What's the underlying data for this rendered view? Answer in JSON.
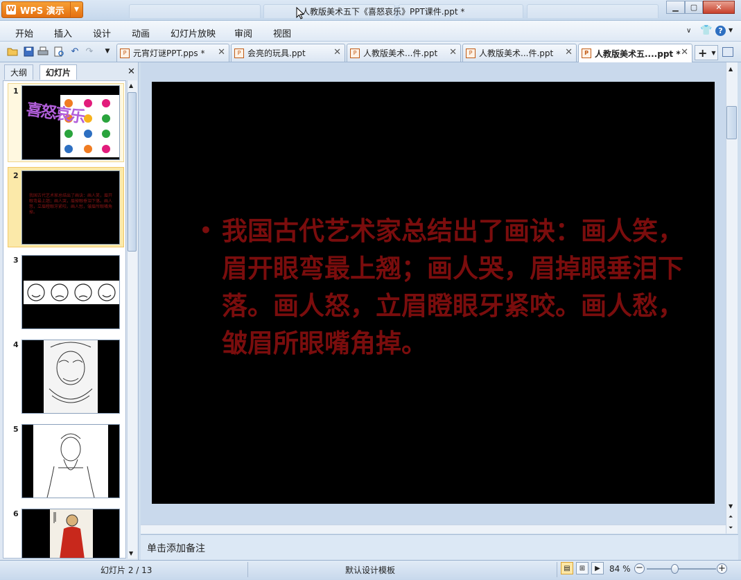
{
  "app": {
    "menu_button": "WPS 演示",
    "logo_letter": "W",
    "window_title": "人教版美术五下《喜怒哀乐》PPT课件.ppt *"
  },
  "window_buttons": {
    "minimize": "▁",
    "maximize": "▢",
    "close": "✕"
  },
  "menu": [
    "开始",
    "插入",
    "设计",
    "动画",
    "幻灯片放映",
    "审阅",
    "视图"
  ],
  "toolbar_icons": [
    "open-icon",
    "save-icon",
    "print-icon",
    "print-preview-icon",
    "undo-icon",
    "redo-icon"
  ],
  "doc_tabs": [
    {
      "label": "元宵灯谜PPT.pps *",
      "active": false
    },
    {
      "label": "会亮的玩具.ppt",
      "active": false
    },
    {
      "label": "人教版美术...件.ppt",
      "active": false
    },
    {
      "label": "人教版美术...件.ppt",
      "active": false
    },
    {
      "label": "人教版美术五....ppt *",
      "active": true
    }
  ],
  "panel_tabs": {
    "outline": "大纲",
    "slides": "幻灯片"
  },
  "thumbnails": [
    {
      "num": "1",
      "title": "喜怒哀乐"
    },
    {
      "num": "2",
      "text": "我国古代艺术家总结出了画诀：画人笑，眉开眼弯最上翘；画人哭，眉掉眼垂泪下落。画人怒，立眉瞪眼牙紧咬。画人愁，皱眉所眼嘴角掉。"
    },
    {
      "num": "3"
    },
    {
      "num": "4"
    },
    {
      "num": "5"
    },
    {
      "num": "6"
    }
  ],
  "slide": {
    "bullet": "•",
    "text": "我国古代艺术家总结出了画诀：画人笑，眉开眼弯最上翘；画人哭，眉掉眼垂泪下落。画人怒，立眉瞪眼牙紧咬。画人愁，皱眉所眼嘴角掉。",
    "text_color": "#7a0d0d"
  },
  "notes": {
    "placeholder": "单击添加备注"
  },
  "status": {
    "slide_counter": "幻灯片 2 / 13",
    "template": "默认设计模板",
    "zoom": "84 %"
  }
}
